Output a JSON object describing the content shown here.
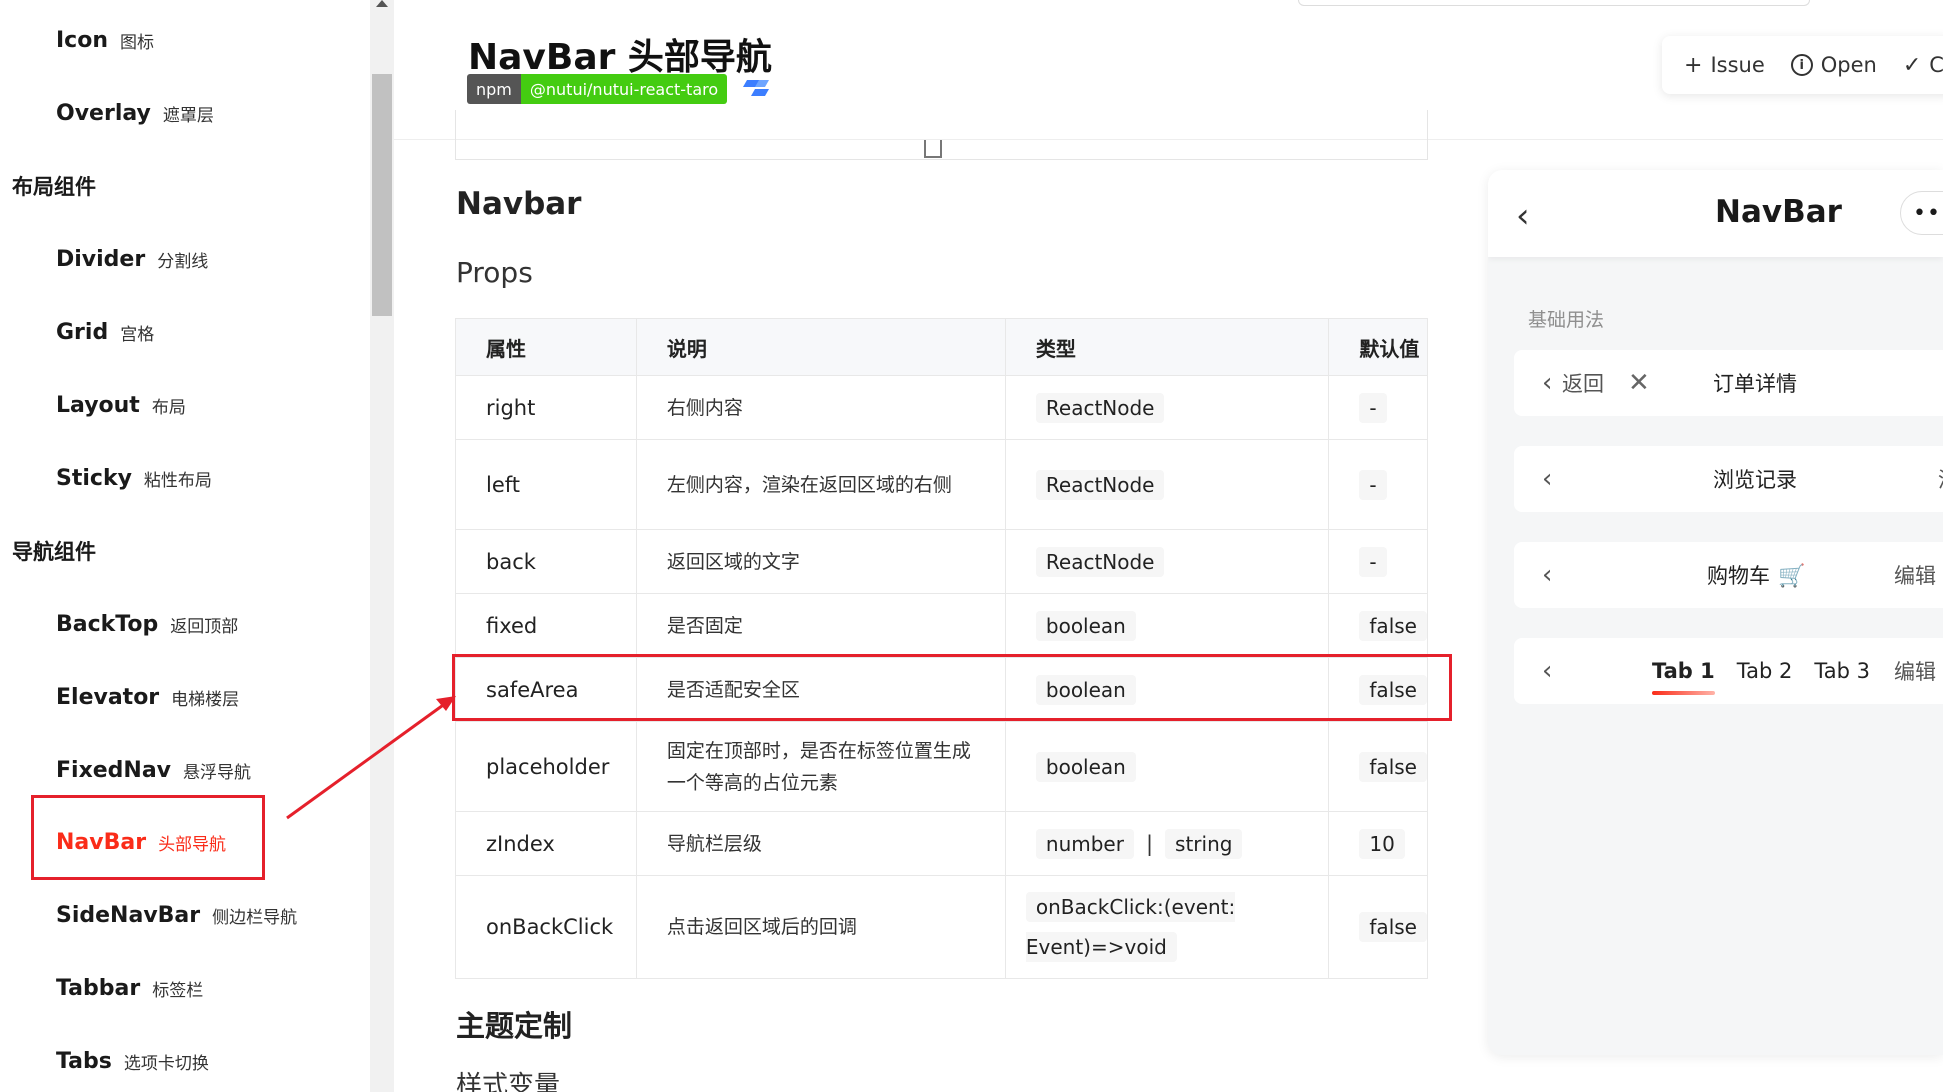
{
  "sidebar": {
    "items": [
      {
        "en": "Icon",
        "zh": "图标"
      },
      {
        "en": "Overlay",
        "zh": "遮罩层"
      },
      {
        "group": "布局组件"
      },
      {
        "en": "Divider",
        "zh": "分割线"
      },
      {
        "en": "Grid",
        "zh": "宫格"
      },
      {
        "en": "Layout",
        "zh": "布局"
      },
      {
        "en": "Sticky",
        "zh": "粘性布局"
      },
      {
        "group": "导航组件"
      },
      {
        "en": "BackTop",
        "zh": "返回顶部"
      },
      {
        "en": "Elevator",
        "zh": "电梯楼层"
      },
      {
        "en": "FixedNav",
        "zh": "悬浮导航"
      },
      {
        "en": "NavBar",
        "zh": "头部导航",
        "active": true
      },
      {
        "en": "SideNavBar",
        "zh": "侧边栏导航"
      },
      {
        "en": "Tabbar",
        "zh": "标签栏"
      },
      {
        "en": "Tabs",
        "zh": "选项卡切换"
      }
    ]
  },
  "header": {
    "title": "NavBar 头部导航",
    "npm_left": "npm",
    "npm_right": "@nutui/nutui-react-taro",
    "actions": {
      "issue": "Issue",
      "open": "Open",
      "third": "C"
    }
  },
  "content": {
    "section_title": "Navbar",
    "props_title": "Props",
    "table": {
      "headers": [
        "属性",
        "说明",
        "类型",
        "默认值"
      ],
      "rows": [
        {
          "prop": "right",
          "desc": "右侧内容",
          "type": [
            "ReactNode"
          ],
          "default": "-"
        },
        {
          "prop": "left",
          "desc": "左侧内容，渲染在返回区域的右侧",
          "type": [
            "ReactNode"
          ],
          "default": "-"
        },
        {
          "prop": "back",
          "desc": "返回区域的文字",
          "type": [
            "ReactNode"
          ],
          "default": "-"
        },
        {
          "prop": "fixed",
          "desc": "是否固定",
          "type": [
            "boolean"
          ],
          "default": "false"
        },
        {
          "prop": "safeArea",
          "desc": "是否适配安全区",
          "type": [
            "boolean"
          ],
          "default": "false"
        },
        {
          "prop": "placeholder",
          "desc": "固定在顶部时，是否在标签位置生成一个等高的占位元素",
          "type": [
            "boolean"
          ],
          "default": "false"
        },
        {
          "prop": "zIndex",
          "desc": "导航栏层级",
          "type": [
            "number",
            "string"
          ],
          "default": "10"
        },
        {
          "prop": "onBackClick",
          "desc": "点击返回区域后的回调",
          "type": [
            "onBackClick:(event: Event)=>void"
          ],
          "default": "false"
        }
      ]
    },
    "theme_title": "主题定制",
    "style_vars": "样式变量"
  },
  "preview": {
    "nav_title": "NavBar",
    "more": "•••",
    "section": "基础用法",
    "demo1": {
      "back": "返回",
      "title": "订单详情"
    },
    "demo2": {
      "title": "浏览记录",
      "right": "清"
    },
    "demo3": {
      "title": "购物车",
      "right": "编辑"
    },
    "demo4": {
      "tabs": [
        "Tab 1",
        "Tab 2",
        "Tab 3"
      ],
      "right": "编辑"
    }
  },
  "annotation_color": "#e5202b",
  "accent_color": "#fa2c19"
}
